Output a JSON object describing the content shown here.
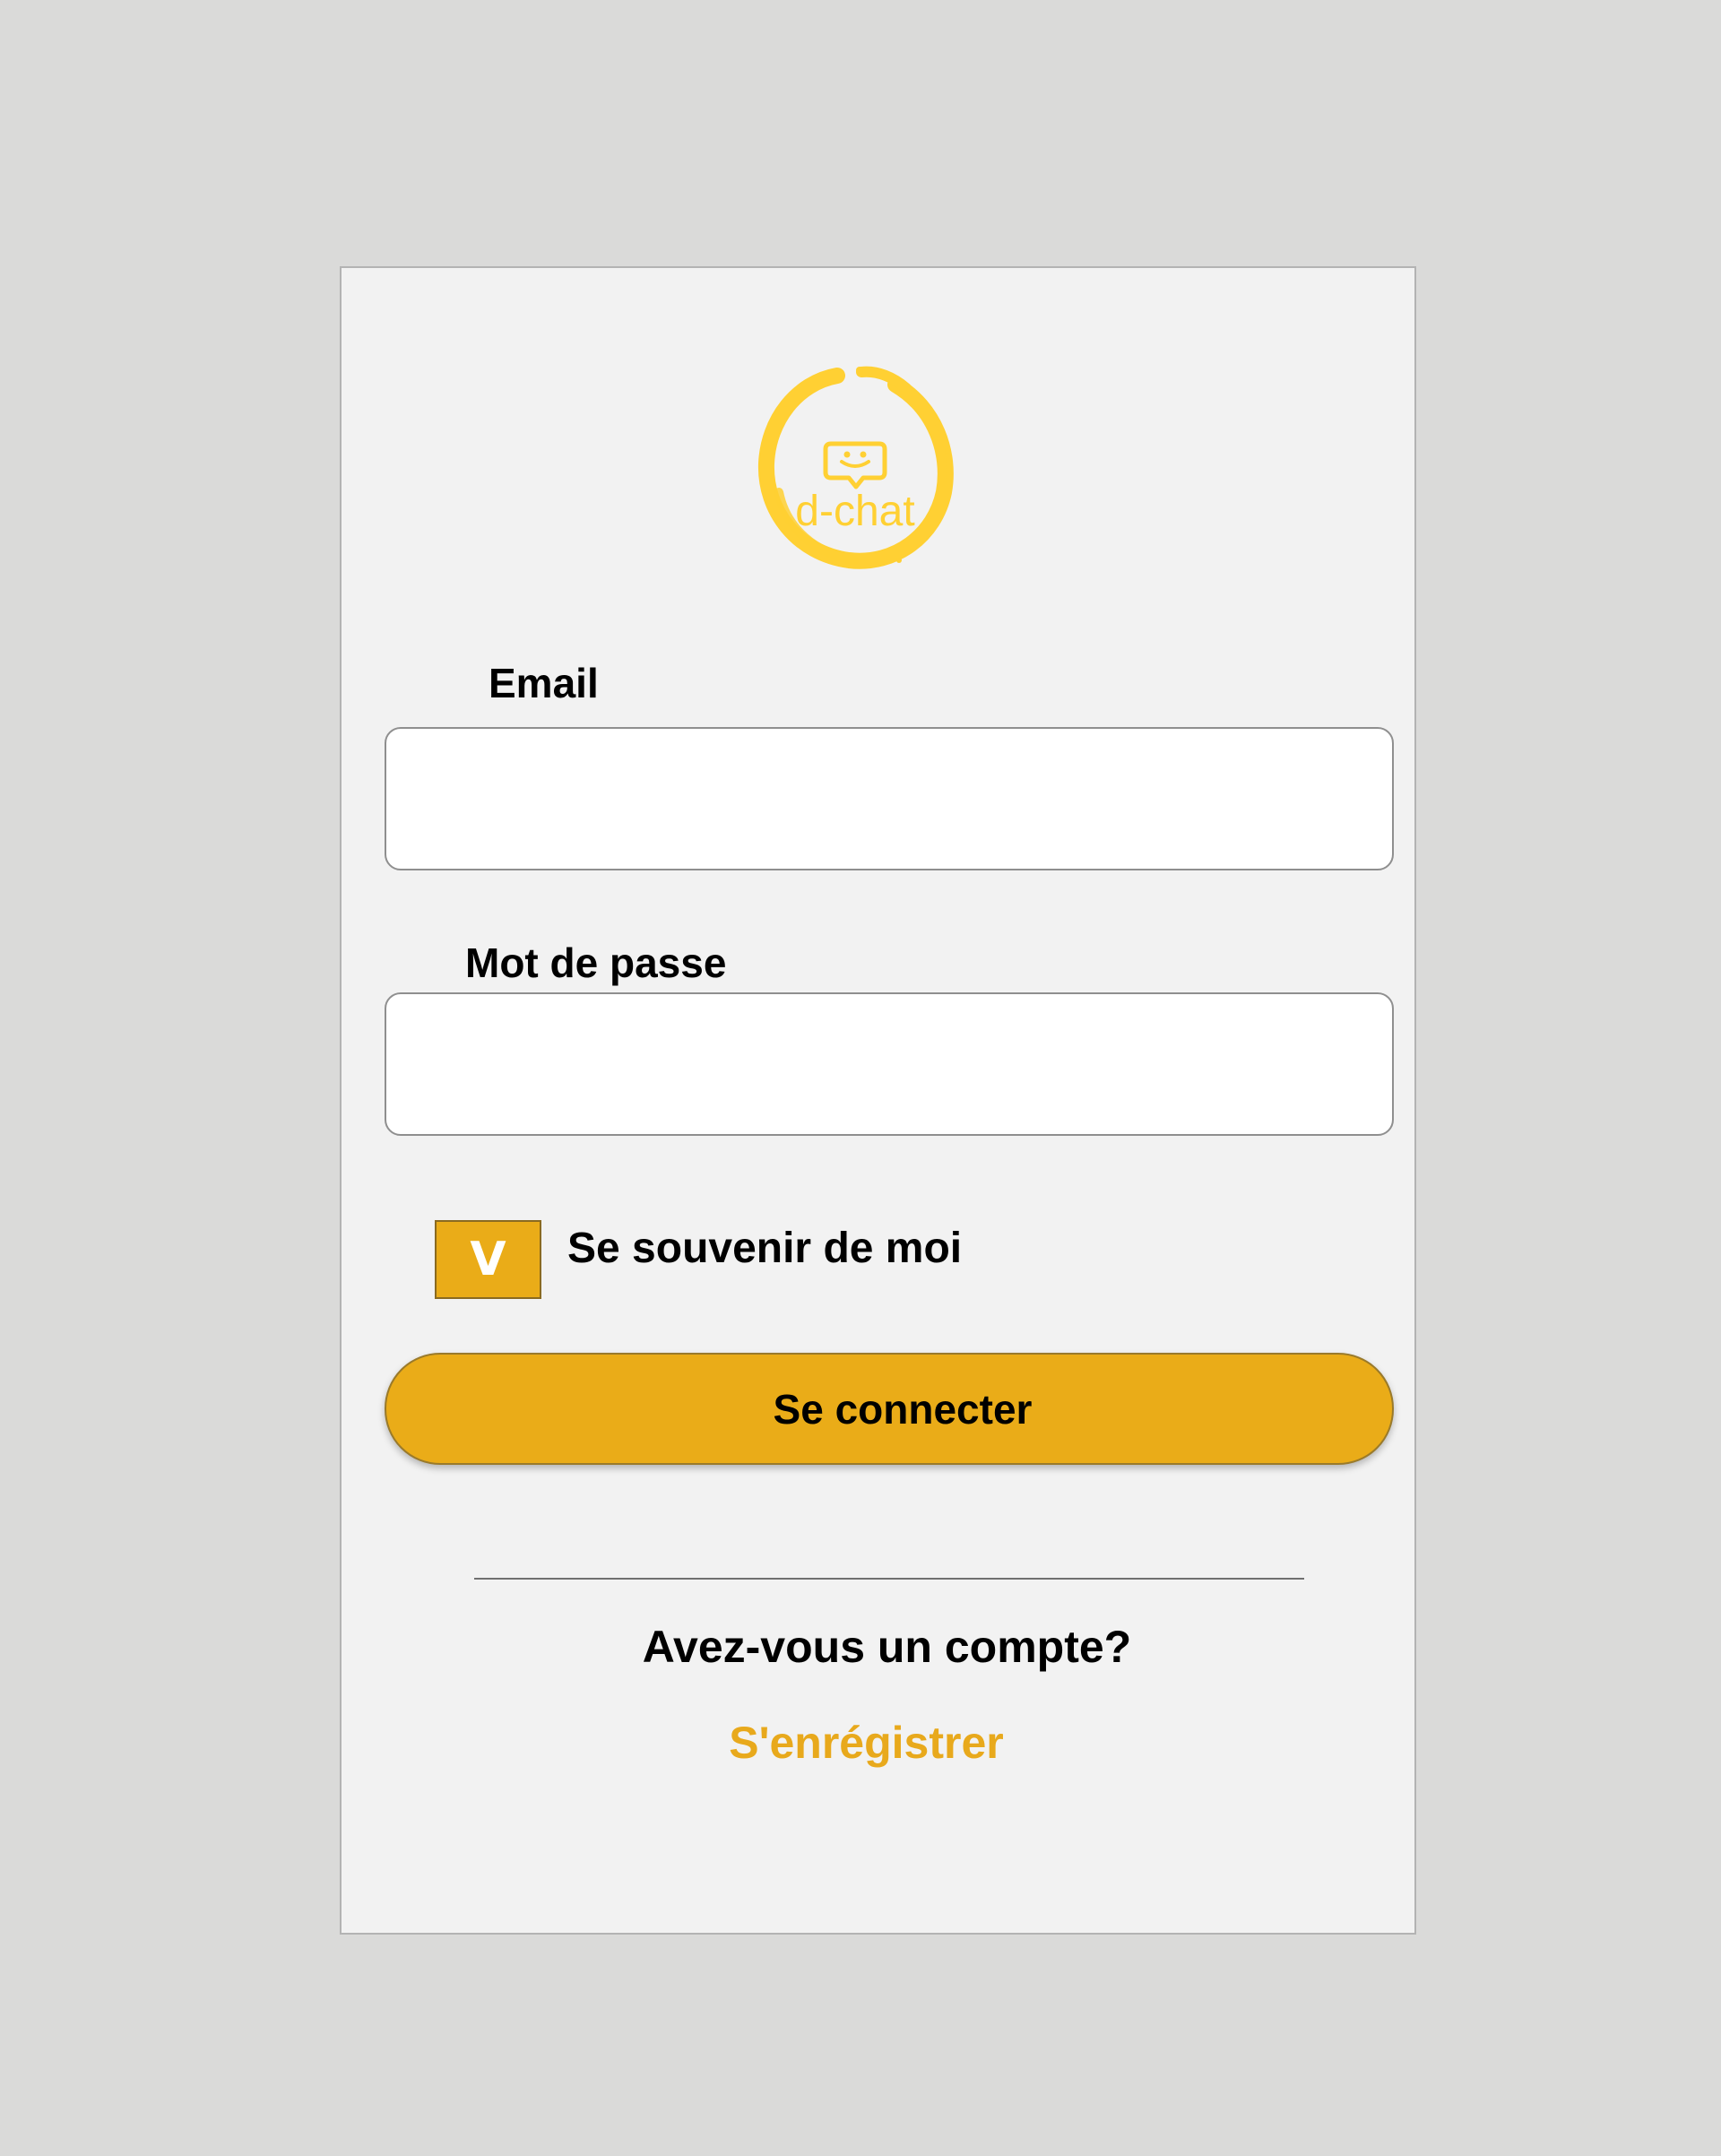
{
  "logo": {
    "text": "d-chat",
    "icon": "smiley-chat-bubble-icon",
    "color": "#ffd033"
  },
  "form": {
    "email_label": "Email",
    "email_value": "",
    "password_label": "Mot de passe",
    "password_value": "",
    "remember": {
      "checked": true,
      "check_glyph": "V",
      "label": "Se souvenir de moi"
    },
    "submit_label": "Se connecter"
  },
  "footer": {
    "question": "Avez-vous un compte?",
    "register_link": "S'enrégistrer"
  },
  "colors": {
    "background": "#dadad9",
    "card": "#f2f2f2",
    "accent": "#eaac18",
    "link": "#e8a91c",
    "logo": "#ffd033"
  }
}
